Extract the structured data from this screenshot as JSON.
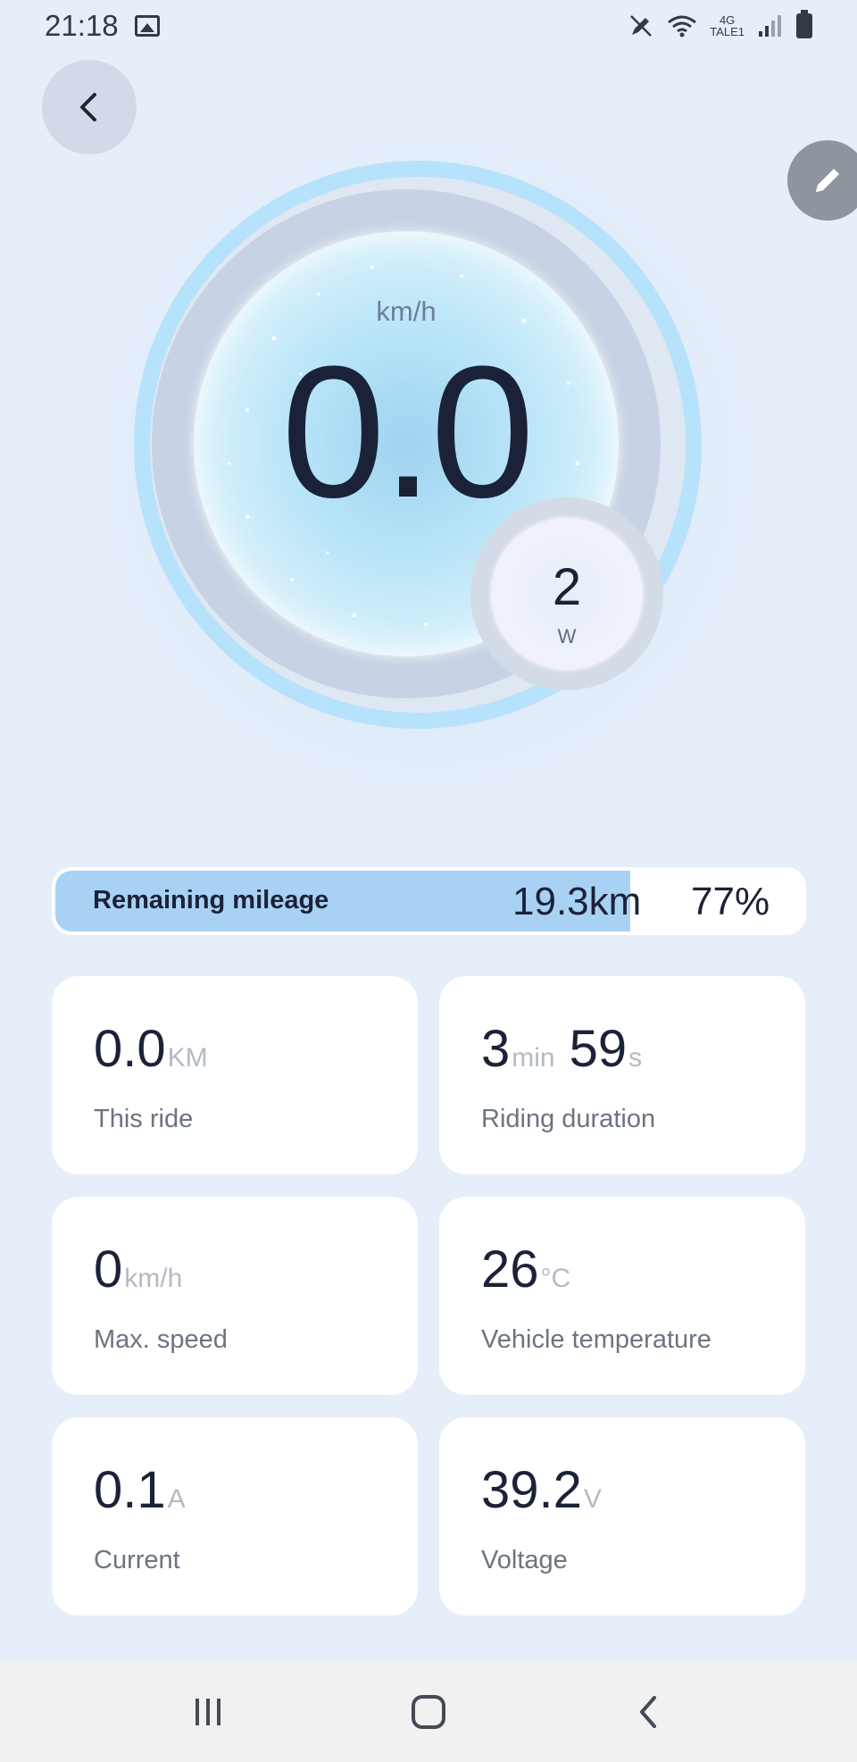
{
  "status_bar": {
    "time": "21:18",
    "network": "4G",
    "carrier_label": "TALE1",
    "icons": [
      "image-icon",
      "edit-pen-icon",
      "wifi-icon",
      "signal-icon",
      "battery-icon"
    ]
  },
  "header": {
    "back_icon": "chevron-left-icon",
    "edit_icon": "pencil-icon"
  },
  "gauge": {
    "speed_unit": "km/h",
    "speed_value": "0.0",
    "power_value": "2",
    "power_unit": "W"
  },
  "mileage": {
    "label": "Remaining mileage",
    "distance": "19.3km",
    "percent_text": "77%",
    "percent": 77
  },
  "stats": [
    {
      "value": "0.0",
      "unit": "KM",
      "label": "This ride"
    },
    {
      "value": "3",
      "unit": "min",
      "value2": "59",
      "unit2": "s",
      "label": "Riding duration"
    },
    {
      "value": "0",
      "unit": "km/h",
      "label": "Max. speed"
    },
    {
      "value": "26",
      "unit": "°C",
      "label": "Vehicle temperature"
    },
    {
      "value": "0.1",
      "unit": "A",
      "label": "Current"
    },
    {
      "value": "39.2",
      "unit": "V",
      "label": "Voltage"
    }
  ],
  "nav": {
    "icons": [
      "recent-apps-icon",
      "home-icon",
      "back-icon"
    ]
  },
  "colors": {
    "background": "#e6eefa",
    "accent_ring": "#b7e2fb",
    "mileage_fill": "#a9d1f3",
    "text_dark": "#1b2238"
  }
}
